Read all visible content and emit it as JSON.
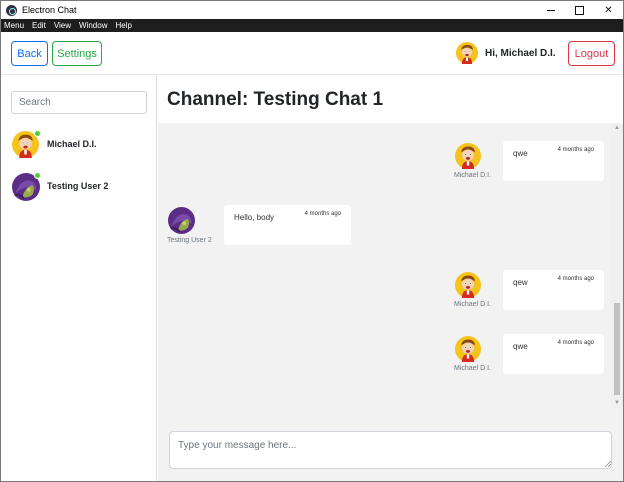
{
  "window": {
    "title": "Electron Chat",
    "controls": {
      "minimize": "–",
      "maximize": "☐",
      "close": "✕"
    }
  },
  "menu": [
    "Menu",
    "Edit",
    "View",
    "Window",
    "Help"
  ],
  "header": {
    "back_label": "Back",
    "settings_label": "Settings",
    "greeting": "Hi, Michael D.I.",
    "logout_label": "Logout",
    "avatar_icon": "cartoon-boy-avatar"
  },
  "sidebar": {
    "search_placeholder": "Search",
    "users": [
      {
        "name": "Michael D.I.",
        "avatar": "cartoon-boy-avatar",
        "online": true
      },
      {
        "name": "Testing User 2",
        "avatar": "purple-character-avatar",
        "online": true
      }
    ]
  },
  "channel": {
    "title": "Channel: Testing Chat 1"
  },
  "messages": [
    {
      "sender": "Michael D.I.",
      "text": "qwe",
      "time": "4 months ago",
      "own": true
    },
    {
      "sender": "Testing User 2",
      "text": "Hello, body",
      "time": "4 months ago",
      "own": false
    },
    {
      "sender": "Michael D.I.",
      "text": "qew",
      "time": "4 months ago",
      "own": true
    },
    {
      "sender": "Michael D.I.",
      "text": "qwe",
      "time": "4 months ago",
      "own": true
    }
  ],
  "composer": {
    "placeholder": "Type your message here..."
  },
  "colors": {
    "primary": "#0d6efd",
    "success": "#28a745",
    "danger": "#dc3545",
    "online": "#4cd137",
    "chat_bg": "#f2f2f2",
    "menubar": "#1e1e1e"
  }
}
